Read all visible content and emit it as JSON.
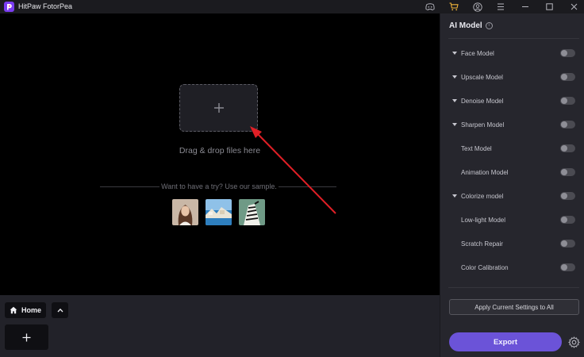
{
  "app": {
    "title": "HitPaw FotorPea",
    "accent": "#6b53d8",
    "title_bar_icons": [
      "discord-icon",
      "cart-icon",
      "user-account-icon",
      "menu-icon",
      "minimize-icon",
      "maximize-icon",
      "close-icon"
    ]
  },
  "canvas": {
    "drop_text": "Drag & drop files here",
    "sample_text": "Want to have a try? Use our sample.",
    "samples": [
      "sample-portrait",
      "sample-coast",
      "sample-zebra"
    ]
  },
  "tray": {
    "home_label": "Home"
  },
  "panel": {
    "title": "AI Model",
    "models": [
      {
        "label": "Face Model",
        "expandable": true,
        "enabled": false
      },
      {
        "label": "Upscale Model",
        "expandable": true,
        "enabled": false
      },
      {
        "label": "Denoise Model",
        "expandable": true,
        "enabled": false
      },
      {
        "label": "Sharpen Model",
        "expandable": true,
        "enabled": false
      },
      {
        "label": "Text Model",
        "expandable": false,
        "enabled": false
      },
      {
        "label": "Animation Model",
        "expandable": false,
        "enabled": false
      },
      {
        "label": "Colorize model",
        "expandable": true,
        "enabled": false
      },
      {
        "label": "Low-light Model",
        "expandable": false,
        "enabled": false
      },
      {
        "label": "Scratch Repair",
        "expandable": false,
        "enabled": false
      },
      {
        "label": "Color Calibration",
        "expandable": false,
        "enabled": false
      }
    ],
    "apply_label": "Apply Current Settings to All",
    "export_label": "Export"
  }
}
